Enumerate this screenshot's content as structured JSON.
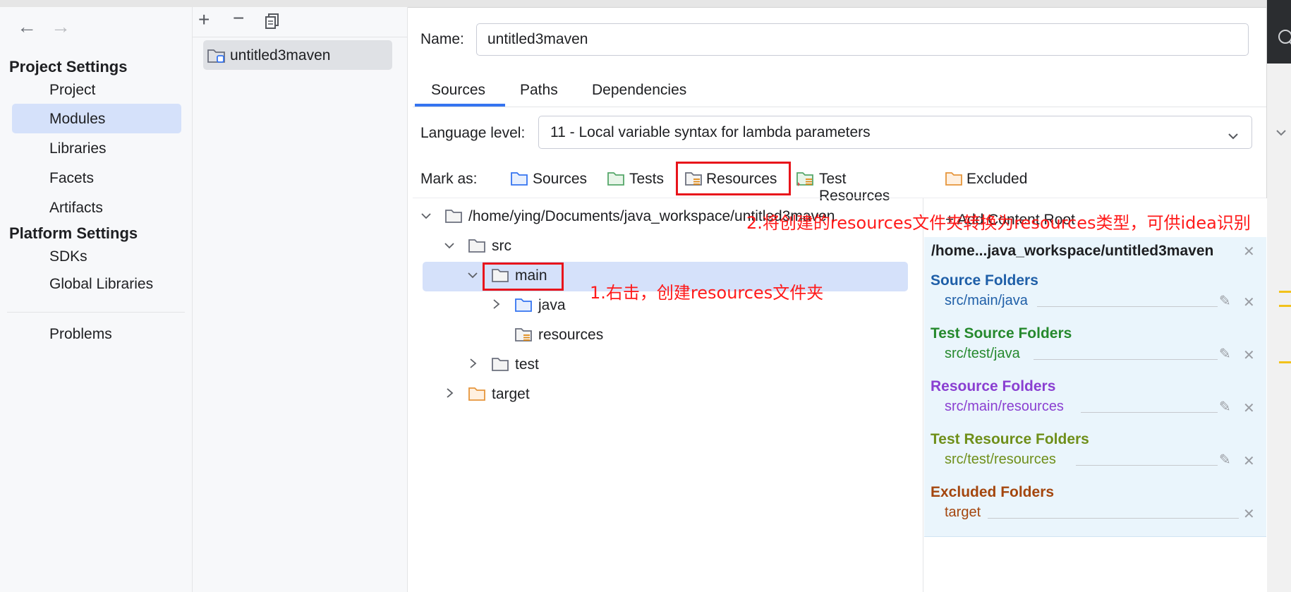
{
  "sidebar": {
    "sections": [
      {
        "title": "Project Settings",
        "items": [
          "Project",
          "Modules",
          "Libraries",
          "Facets",
          "Artifacts"
        ]
      },
      {
        "title": "Platform Settings",
        "items": [
          "SDKs",
          "Global Libraries"
        ]
      }
    ],
    "problems": "Problems",
    "selected": "Modules"
  },
  "modules": {
    "items": [
      "untitled3maven"
    ]
  },
  "form": {
    "name_label": "Name:",
    "name_value": "untitled3maven"
  },
  "tabs": [
    "Sources",
    "Paths",
    "Dependencies"
  ],
  "active_tab": "Sources",
  "language": {
    "label": "Language level:",
    "value": "11 - Local variable syntax for lambda parameters"
  },
  "mark_as": {
    "label": "Mark as:",
    "buttons": [
      "Sources",
      "Tests",
      "Resources",
      "Test Resources",
      "Excluded"
    ]
  },
  "tree": {
    "root": "/home/ying/Documents/java_workspace/untitled3maven",
    "nodes": [
      "src",
      "main",
      "java",
      "resources",
      "test",
      "target"
    ],
    "selected": "main"
  },
  "content_root": {
    "add_label": "+ Add Content Root",
    "path": "/home...java_workspace/untitled3maven",
    "groups": [
      {
        "title": "Source Folders",
        "item": "src/main/java",
        "color": "#1f5fa8"
      },
      {
        "title": "Test Source Folders",
        "item": "src/test/java",
        "color": "#25892d"
      },
      {
        "title": "Resource Folders",
        "item": "src/main/resources",
        "color": "#8a3fd1"
      },
      {
        "title": "Test Resource Folders",
        "item": "src/test/resources",
        "color": "#6f8f1a"
      },
      {
        "title": "Excluded Folders",
        "item": "target",
        "color": "#a4460e"
      }
    ]
  },
  "annotations": {
    "step1": "1.右击，创建resources文件夹",
    "step2": "2.将创建的resources文件夹转换为resources类型，可供idea识别"
  }
}
